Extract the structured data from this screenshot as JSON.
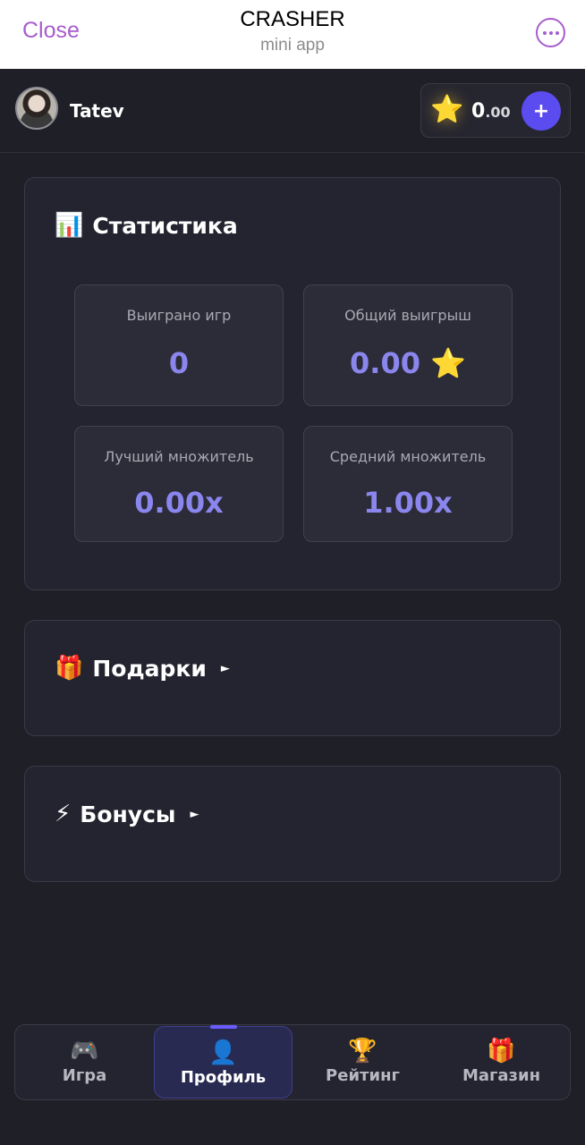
{
  "telegram_bar": {
    "close_label": "Close",
    "title": "CRASHER",
    "subtitle": "mini app",
    "more_icon": "ellipsis-circle-icon"
  },
  "header": {
    "username": "Tatev",
    "balance_int": "0",
    "balance_dec": ".00",
    "star_icon": "⭐",
    "add_label": "+"
  },
  "stats": {
    "icon": "📊",
    "title": "Статистика",
    "items": [
      {
        "label": "Выиграно игр",
        "value": "0"
      },
      {
        "label": "Общий выигрыш",
        "value": "0.00 ⭐"
      },
      {
        "label": "Лучший множитель",
        "value": "0.00x"
      },
      {
        "label": "Средний множитель",
        "value": "1.00x"
      }
    ]
  },
  "gifts": {
    "icon": "🎁",
    "title": "Подарки",
    "arrow": "►"
  },
  "bonuses": {
    "icon": "⚡",
    "title": "Бонусы",
    "arrow": "►"
  },
  "nav": {
    "items": [
      {
        "icon": "🎮",
        "label": "Игра"
      },
      {
        "icon": "👤",
        "label": "Профиль"
      },
      {
        "icon": "🏆",
        "label": "Рейтинг"
      },
      {
        "icon": "🎁",
        "label": "Магазин"
      }
    ],
    "active_index": 1
  },
  "colors": {
    "accent": "#a75ccf",
    "value": "#8a86ee",
    "button": "#5b4cf0",
    "background": "#1f1f27"
  }
}
